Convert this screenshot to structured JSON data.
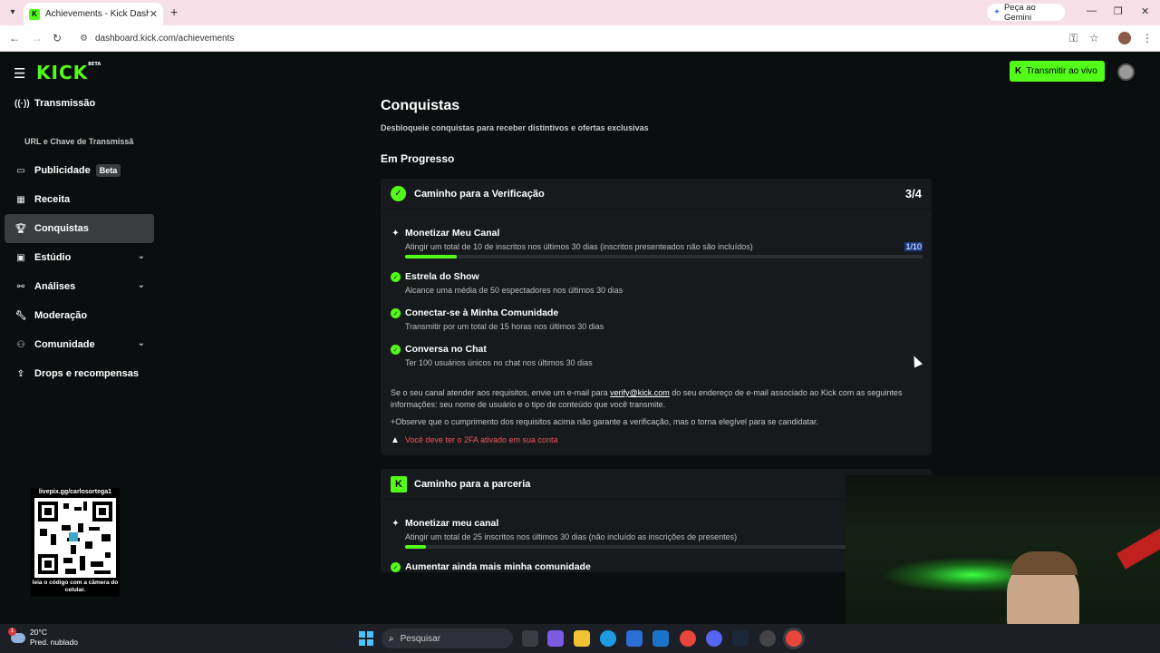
{
  "browser": {
    "tab_title": "Achievements - Kick Dashboard",
    "tab_close": "✕",
    "new_tab": "+",
    "gemini_label": "Peça ao Gemini",
    "url": "dashboard.kick.com/achievements"
  },
  "header": {
    "logo": "KICK",
    "logo_sup": "BETA",
    "go_live_label": "Transmitir ao vivo"
  },
  "sidebar": {
    "items": [
      {
        "label": "Transmissão"
      },
      {
        "label": "URL e Chave de Transmissã"
      },
      {
        "label": "Publicidade",
        "badge": "Beta"
      },
      {
        "label": "Receita"
      },
      {
        "label": "Conquistas"
      },
      {
        "label": "Estúdio"
      },
      {
        "label": "Análises"
      },
      {
        "label": "Moderação"
      },
      {
        "label": "Comunidade"
      },
      {
        "label": "Drops e recompensas"
      }
    ]
  },
  "qr": {
    "top": "livepix.gg/carlosortega1",
    "bottom": "leia o código com a câmera do celular."
  },
  "page": {
    "title": "Conquistas",
    "subtitle": "Desbloqueie conquistas para receber distintivos e ofertas exclusivas",
    "section": "Em Progresso"
  },
  "card1": {
    "title": "Caminho para a Verificação",
    "progress": "3/4",
    "tasks": [
      {
        "title": "Monetizar Meu Canal",
        "desc": "Atingir um total de 10 de inscritos nos últimos 30 dias (inscritos presenteados não são incluídos)",
        "count": "1/10",
        "progress": 0.1
      },
      {
        "title": "Estrela do Show",
        "desc": "Alcance uma média de 50 espectadores nos últimos 30 dias"
      },
      {
        "title": "Conectar-se à Minha Comunidade",
        "desc": "Transmitir por um total de 15 horas nos últimos 30 dias"
      },
      {
        "title": "Conversa no Chat",
        "desc": "Ter 100 usuários únicos no chat nos últimos 30 dias"
      }
    ],
    "note_pre": "Se o seu canal atender aos requisitos, envie um e-mail para ",
    "note_email": "verify@kick.com",
    "note_post": " do seu endereço de e-mail associado ao Kick com as seguintes informações: seu nome de usuário e o tipo de conteúdo que você transmite.",
    "note2": "+Observe que o cumprimento dos requisitos acima não garante a verificação, mas o torna elegível para se candidatar.",
    "warning": "Você deve ter o 2FA ativado em sua conta"
  },
  "card2": {
    "title": "Caminho para a parceria",
    "tasks": [
      {
        "title": "Monetizar meu canal",
        "desc": "Atingir um total de 25 inscritos nos últimos 30 dias (não incluído as inscrições de presentes)",
        "progress": 0.04
      },
      {
        "title": "Aumentar ainda mais minha comunidade"
      }
    ]
  },
  "taskbar": {
    "weather_temp": "20°C",
    "weather_desc": "Pred. nublado",
    "notif_count": "1",
    "search_placeholder": "Pesquisar"
  },
  "colors": {
    "accent": "#53fc18",
    "background": "#0b0e0f",
    "card": "#171a1c",
    "warning": "#f0545f"
  }
}
